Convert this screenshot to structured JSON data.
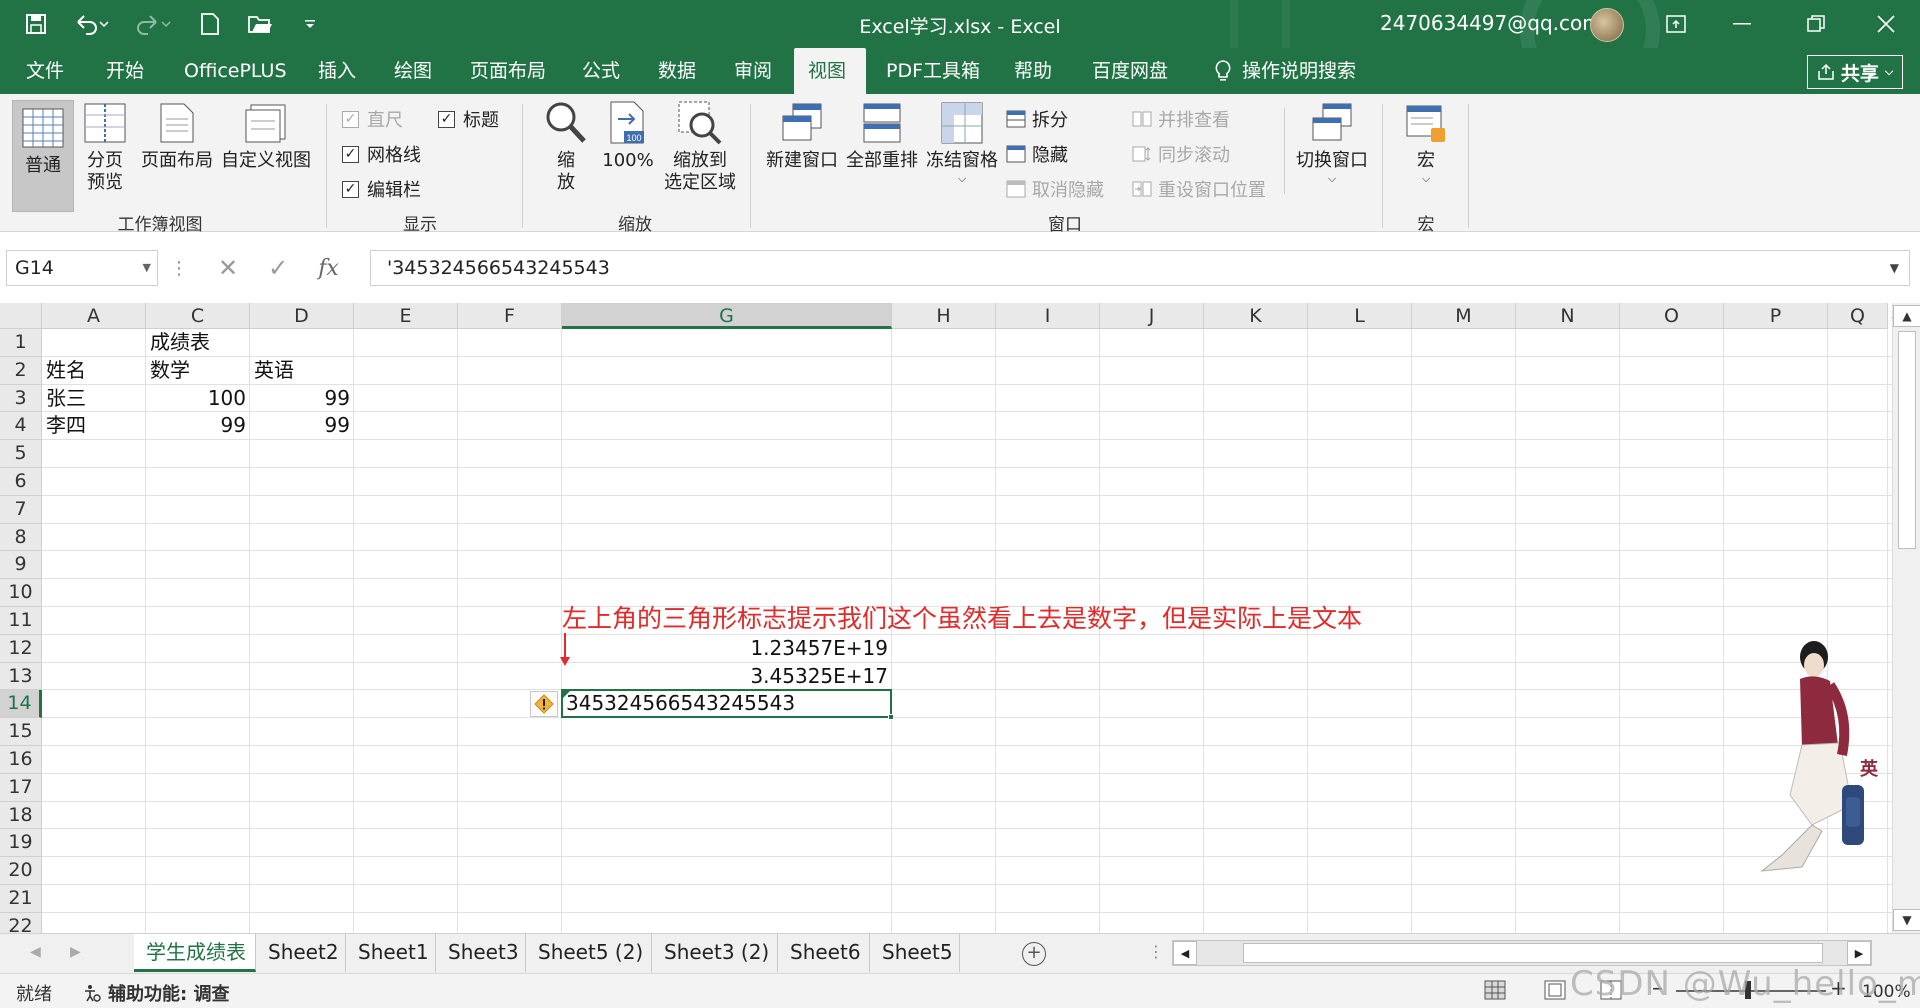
{
  "window": {
    "title": "Excel学习.xlsx  -  Excel",
    "account": "2470634497@qq.com",
    "share_label": "共享",
    "colors": {
      "brand": "#217346",
      "annotation": "#e12a2a"
    }
  },
  "qat": {
    "icons": [
      "save-icon",
      "undo-icon",
      "redo-icon",
      "new-file-icon",
      "open-folder-icon",
      "customize-qat-icon"
    ]
  },
  "menu_tabs": [
    "文件",
    "开始",
    "OfficePLUS",
    "插入",
    "绘图",
    "页面布局",
    "公式",
    "数据",
    "审阅",
    "视图",
    "PDF工具箱",
    "帮助",
    "百度网盘"
  ],
  "active_tab": "视图",
  "tell_me": "操作说明搜索",
  "ribbon": {
    "workbook_views": {
      "label": "工作簿视图",
      "normal": "普通",
      "page_break_1": "分页",
      "page_break_2": "预览",
      "page_layout": "页面布局",
      "custom_views": "自定义视图"
    },
    "show": {
      "label": "显示",
      "ruler": "直尺",
      "gridlines": "网格线",
      "formula_bar": "编辑栏",
      "headings": "标题"
    },
    "zoom": {
      "label": "缩放",
      "zoom_1": "缩",
      "zoom_2": "放",
      "zoom_100": "100%",
      "zoom_sel_1": "缩放到",
      "zoom_sel_2": "选定区域"
    },
    "window": {
      "label": "窗口",
      "new_window": "新建窗口",
      "arrange_all": "全部重排",
      "freeze": "冻结窗格",
      "split": "拆分",
      "hide": "隐藏",
      "unhide": "取消隐藏",
      "side_by_side": "并排查看",
      "sync_scroll": "同步滚动",
      "reset_position": "重设窗口位置",
      "switch": "切换窗口"
    },
    "macros": {
      "label": "宏",
      "macros": "宏"
    }
  },
  "formula_bar": {
    "name_box": "G14",
    "fx": "fx",
    "content": "'345324566543245543"
  },
  "columns": [
    "A",
    "C",
    "D",
    "E",
    "F",
    "G",
    "H",
    "I",
    "J",
    "K",
    "L",
    "M",
    "N",
    "O",
    "P",
    "Q"
  ],
  "rows": [
    "1",
    "2",
    "3",
    "4",
    "5",
    "6",
    "7",
    "8",
    "9",
    "10",
    "11",
    "12",
    "13",
    "14",
    "15",
    "16",
    "17",
    "18",
    "19",
    "20",
    "21",
    "22"
  ],
  "cells": {
    "c1": "成绩表",
    "a2": "姓名",
    "c2": "数学",
    "d2": "英语",
    "a3": "张三",
    "c3": "100",
    "d3": "99",
    "a4": "李四",
    "c4": "99",
    "d4": "99",
    "g12": "1.23457E+19",
    "g13": "3.45325E+17",
    "g14": "345324566543245543"
  },
  "annotation": "左上角的三角形标志提示我们这个虽然看上去是数字，但是实际上是文本",
  "decor_text": "英",
  "sheets": [
    "学生成绩表",
    "Sheet2",
    "Sheet1",
    "Sheet3",
    "Sheet5 (2)",
    "Sheet3 (2)",
    "Sheet6",
    "Sheet5"
  ],
  "active_sheet": "学生成绩表",
  "status": {
    "ready": "就绪",
    "accessibility": "辅助功能: 调查",
    "zoom": "100%"
  },
  "watermark": "CSDN @Wu_hello_mi"
}
